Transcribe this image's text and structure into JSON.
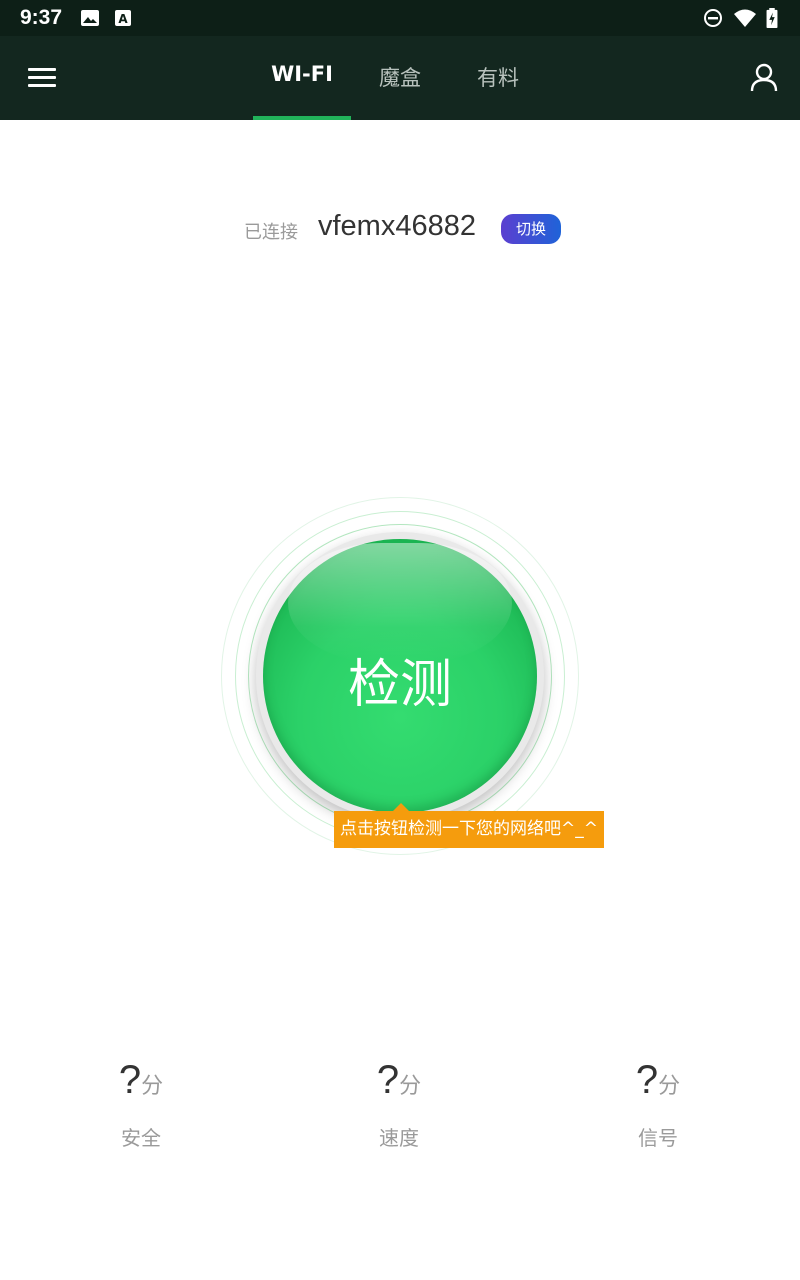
{
  "status_bar": {
    "time": "9:37",
    "icons": [
      "image-icon",
      "keyboard-a-icon",
      "do-not-disturb-icon",
      "wifi-icon",
      "battery-charging-icon"
    ]
  },
  "app_bar": {
    "tabs": [
      {
        "label": "WI-FI",
        "active": true
      },
      {
        "label": "魔盒",
        "active": false
      },
      {
        "label": "有料",
        "active": false
      }
    ],
    "accent_color": "#21b35a"
  },
  "connection": {
    "status_label": "已连接",
    "ssid": "vfemx46882",
    "switch_label": "切换"
  },
  "detect": {
    "button_label": "检测",
    "tip": "点击按钮检测一下您的网络吧^_^",
    "tip_color": "#f59c0d"
  },
  "scores": [
    {
      "value": "?",
      "unit": "分",
      "label": "安全"
    },
    {
      "value": "?",
      "unit": "分",
      "label": "速度"
    },
    {
      "value": "?",
      "unit": "分",
      "label": "信号"
    }
  ]
}
